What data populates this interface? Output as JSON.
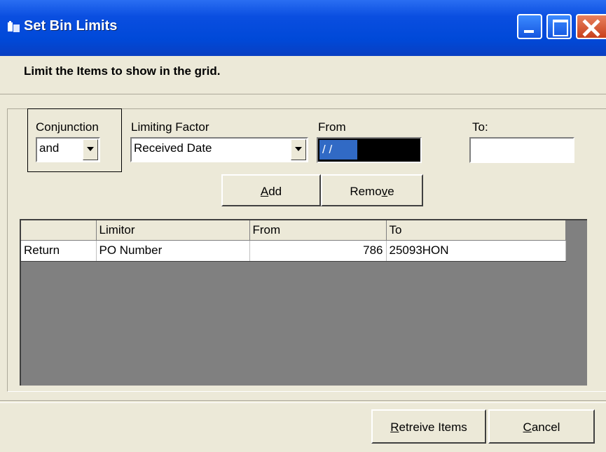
{
  "window": {
    "title": "Set Bin Limits",
    "instruction": "Limit the Items to show in the grid."
  },
  "filter": {
    "conjunction_label": "Conjunction",
    "conjunction_value": "and",
    "limiting_factor_label": "Limiting Factor",
    "limiting_factor_value": "Received Date",
    "from_label": "From",
    "from_value": "/ /",
    "to_label": "To:",
    "to_value": ""
  },
  "buttons": {
    "add": {
      "pre": "",
      "key": "A",
      "post": "dd"
    },
    "remove": {
      "pre": "Remo",
      "key": "v",
      "post": "e"
    },
    "retrieve": {
      "pre": "",
      "key": "R",
      "post": "etreive Items"
    },
    "cancel": {
      "pre": "",
      "key": "C",
      "post": "ancel"
    }
  },
  "grid": {
    "columns": [
      "",
      "Limitor",
      "From",
      "To"
    ],
    "rows": [
      [
        "Return",
        "PO Number",
        "786",
        "25093HON"
      ]
    ]
  }
}
